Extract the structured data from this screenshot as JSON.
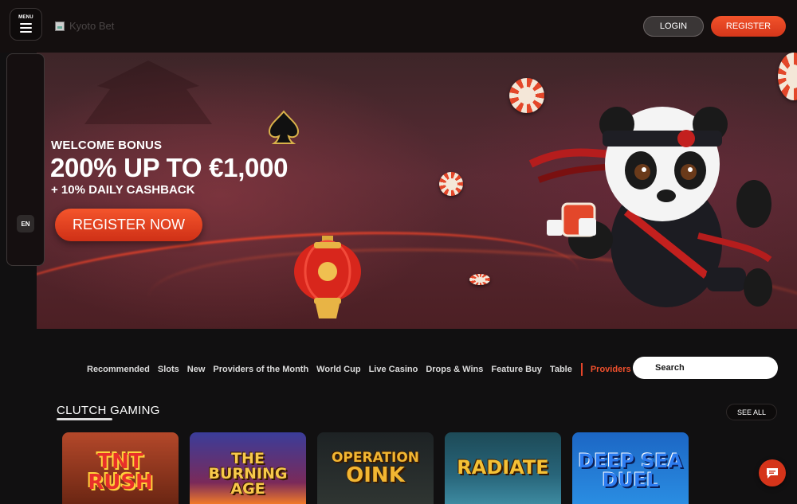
{
  "header": {
    "menu_label": "MENU",
    "logo_alt": "Kyoto Bet",
    "login_label": "LOGIN",
    "register_label": "REGISTER"
  },
  "side_rail": {
    "language": "EN"
  },
  "banner": {
    "headline": "WELCOME BONUS",
    "amount": "200% UP TO €1,000",
    "cashback": "+ 10% DAILY CASHBACK",
    "cta_label": "REGISTER NOW"
  },
  "categories": {
    "items": [
      "Recommended",
      "Slots",
      "New",
      "Providers of the Month",
      "World Cup",
      "Live Casino",
      "Drops & Wins",
      "Feature Buy",
      "Table"
    ],
    "providers_label": "Providers"
  },
  "search": {
    "placeholder": "Search"
  },
  "section": {
    "title": "CLUTCH GAMING",
    "see_all_label": "SEE ALL",
    "games": [
      {
        "title_line1": "TNT",
        "title_line2": "RUSH"
      },
      {
        "title_line1": "THE",
        "title_line2": "BURNING AGE"
      },
      {
        "title_line1": "OPERATION",
        "title_line2": "OINK"
      },
      {
        "title_line1": "RADIATE",
        "title_line2": ""
      },
      {
        "title_line1": "DEEP SEA",
        "title_line2": "DUEL"
      }
    ]
  },
  "colors": {
    "accent": "#e5452a",
    "background": "#111011"
  },
  "icons": {
    "menu": "hamburger-icon",
    "chat": "chat-icon"
  }
}
